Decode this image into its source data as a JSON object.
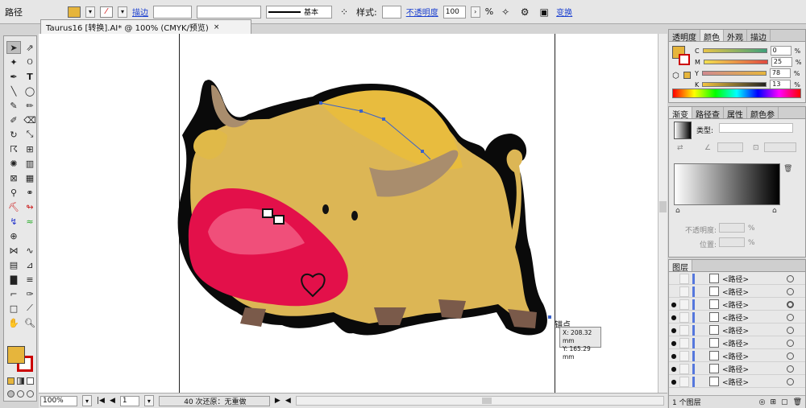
{
  "control_bar": {
    "object_type": "路径",
    "fill_color": "#e6b53c",
    "stroke_label": "描边",
    "stroke_weight": "",
    "stroke_style": "基本",
    "style_label": "样式:",
    "opacity_label": "不透明度",
    "opacity_value": "100",
    "opacity_unit": "%",
    "transform_link": "变换"
  },
  "document_tab": {
    "title": "Taurus16 [转换].AI* @ 100% (CMYK/预览)",
    "close": "×"
  },
  "tools": {
    "fill_color": "#e6b53c",
    "stroke_color": "#cc0000",
    "items": [
      "selection-arrow",
      "direct-selection",
      "magic-wand",
      "lasso",
      "pen",
      "type",
      "line",
      "ellipse",
      "paintbrush",
      "pencil",
      "blob-brush",
      "eraser",
      "rotate",
      "scale",
      "warp",
      "free-transform",
      "symbol-sprayer",
      "column-graph",
      "mesh",
      "gradient",
      "eyedropper",
      "blend",
      "live-paint",
      "live-paint-select",
      "slice",
      "scissors",
      "hand",
      "zoom"
    ]
  },
  "canvas": {
    "anchor_tooltip": "锚点",
    "coord_x": "X: 208.32 mm",
    "coord_y": "Y: 165.29 mm"
  },
  "status_bar": {
    "zoom": "100%",
    "artboard": "1",
    "undo_status": "40 次还原：无重做"
  },
  "color_panel": {
    "tabs": [
      "透明度",
      "颜色",
      "外观",
      "描边"
    ],
    "active_tab": "颜色",
    "channels": [
      {
        "name": "C",
        "value": "0"
      },
      {
        "name": "M",
        "value": "25"
      },
      {
        "name": "Y",
        "value": "78"
      },
      {
        "name": "K",
        "value": "13"
      }
    ],
    "percent": "%"
  },
  "gradient_panel": {
    "tabs": [
      "渐变",
      "路径查",
      "属性",
      "颜色参"
    ],
    "active_tab": "渐变",
    "type_label": "类型:",
    "opacity_label": "不透明度:",
    "position_label": "位置:",
    "pct": "%"
  },
  "layers_panel": {
    "tab": "图层",
    "rows": [
      {
        "name": "<路径>",
        "eye": ""
      },
      {
        "name": "<路径>",
        "eye": ""
      },
      {
        "name": "<路径>",
        "eye": "●"
      },
      {
        "name": "<路径>",
        "eye": "●"
      },
      {
        "name": "<路径>",
        "eye": "●"
      },
      {
        "name": "<路径>",
        "eye": "●"
      },
      {
        "name": "<路径>",
        "eye": "●"
      },
      {
        "name": "<路径>",
        "eye": "●"
      },
      {
        "name": "<路径>",
        "eye": "●"
      }
    ],
    "footer": "1 个图层"
  }
}
